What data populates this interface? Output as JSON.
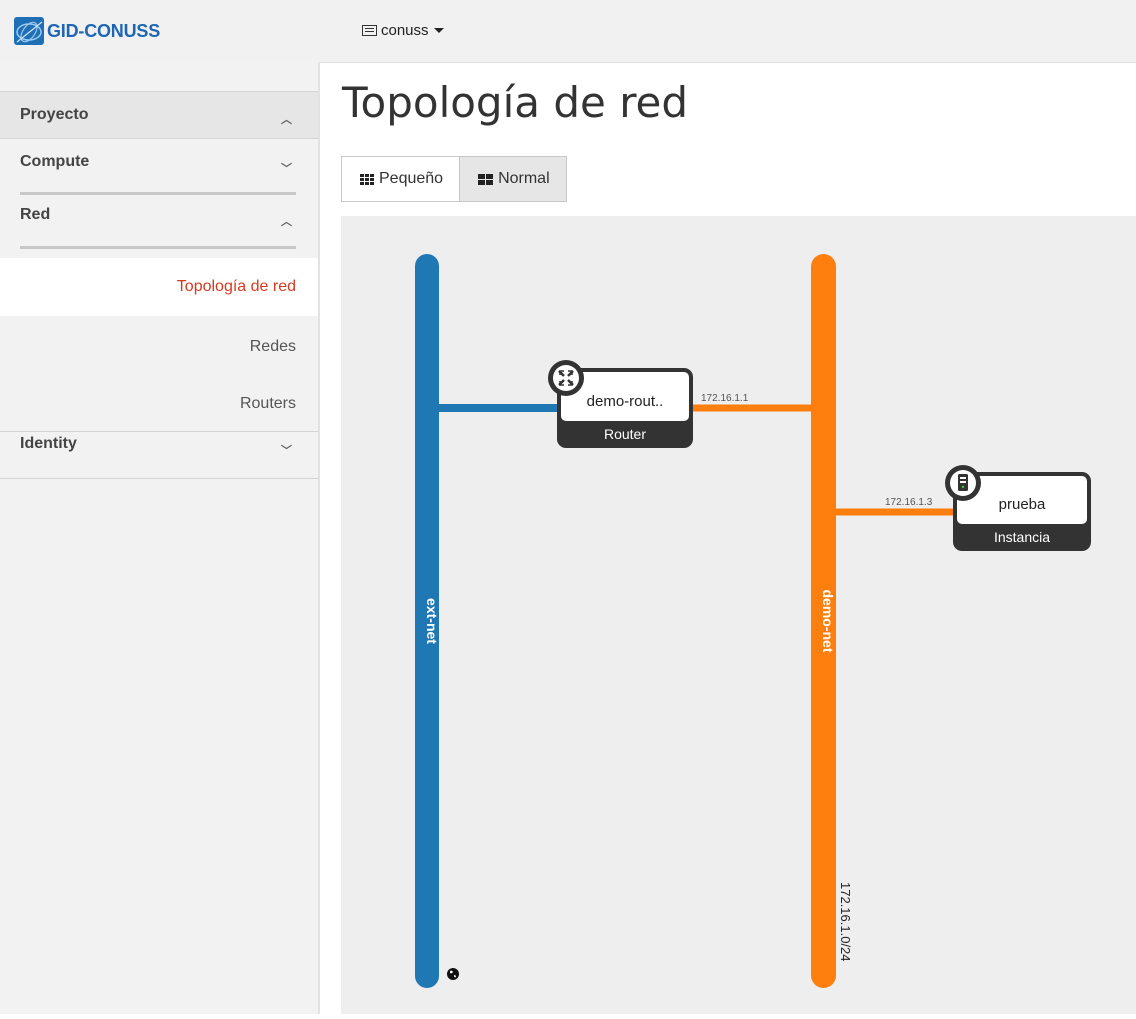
{
  "header": {
    "brand": "GID-CONUSS",
    "project_label": "conuss"
  },
  "sidebar": {
    "proyecto": "Proyecto",
    "compute": "Compute",
    "red": "Red",
    "items": [
      "Topología de red",
      "Redes",
      "Routers"
    ],
    "identity": "Identity"
  },
  "page": {
    "title": "Topología de red",
    "btn_small": "Pequeño",
    "btn_normal": "Normal"
  },
  "topology": {
    "networks": [
      {
        "name": "ext-net",
        "color": "#1f77b4",
        "cidr": ""
      },
      {
        "name": "demo-net",
        "color": "#ff7f0e",
        "cidr": "172.16.1.0/24"
      }
    ],
    "router": {
      "name": "demo-rout..",
      "type": "Router",
      "ip": "172.16.1.1"
    },
    "instance": {
      "name": "prueba",
      "type": "Instancia",
      "ip": "172.16.1.3"
    }
  },
  "colors": {
    "active_link": "#d9391f",
    "node_dark": "#333333"
  }
}
